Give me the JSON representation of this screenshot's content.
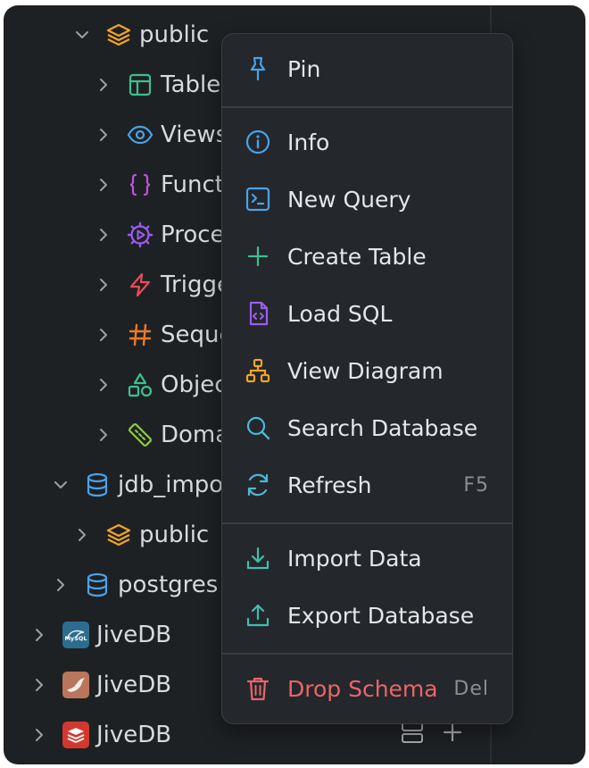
{
  "tree": {
    "rows": [
      {
        "label": "public",
        "icon": "schema-layers-icon",
        "expanded": true
      },
      {
        "label": "Table",
        "icon": "table-icon"
      },
      {
        "label": "Views",
        "icon": "eye-icon"
      },
      {
        "label": "Funct",
        "icon": "braces-icon"
      },
      {
        "label": "Proce",
        "icon": "gear-play-icon"
      },
      {
        "label": "Trigge",
        "icon": "lightning-icon"
      },
      {
        "label": "Seque",
        "icon": "hash-icon"
      },
      {
        "label": "Objec",
        "icon": "shapes-icon"
      },
      {
        "label": "Doma",
        "icon": "ruler-icon"
      },
      {
        "label": "jdb_impo",
        "icon": "database-icon",
        "expanded": true
      },
      {
        "label": "public",
        "icon": "schema-layers-icon"
      },
      {
        "label": "postgres",
        "icon": "database-icon"
      },
      {
        "label": "JiveDB",
        "icon": "mysql-logo-icon"
      },
      {
        "label": "JiveDB",
        "icon": "mariadb-logo-icon"
      },
      {
        "label": "JiveDB",
        "icon": "redis-logo-icon"
      }
    ]
  },
  "menu": {
    "pin": "Pin",
    "info": "Info",
    "new_query": "New Query",
    "create_table": "Create Table",
    "load_sql": "Load SQL",
    "view_diagram": "View Diagram",
    "search_database": "Search Database",
    "refresh": "Refresh",
    "refresh_key": "F5",
    "import_data": "Import Data",
    "export_database": "Export Database",
    "drop_schema": "Drop Schema",
    "drop_key": "Del"
  },
  "colors": {
    "background": "#1e2124",
    "menu_background": "#24272b",
    "danger": "#e8666b",
    "schema": "#f0a528",
    "database": "#4aa3e8"
  }
}
